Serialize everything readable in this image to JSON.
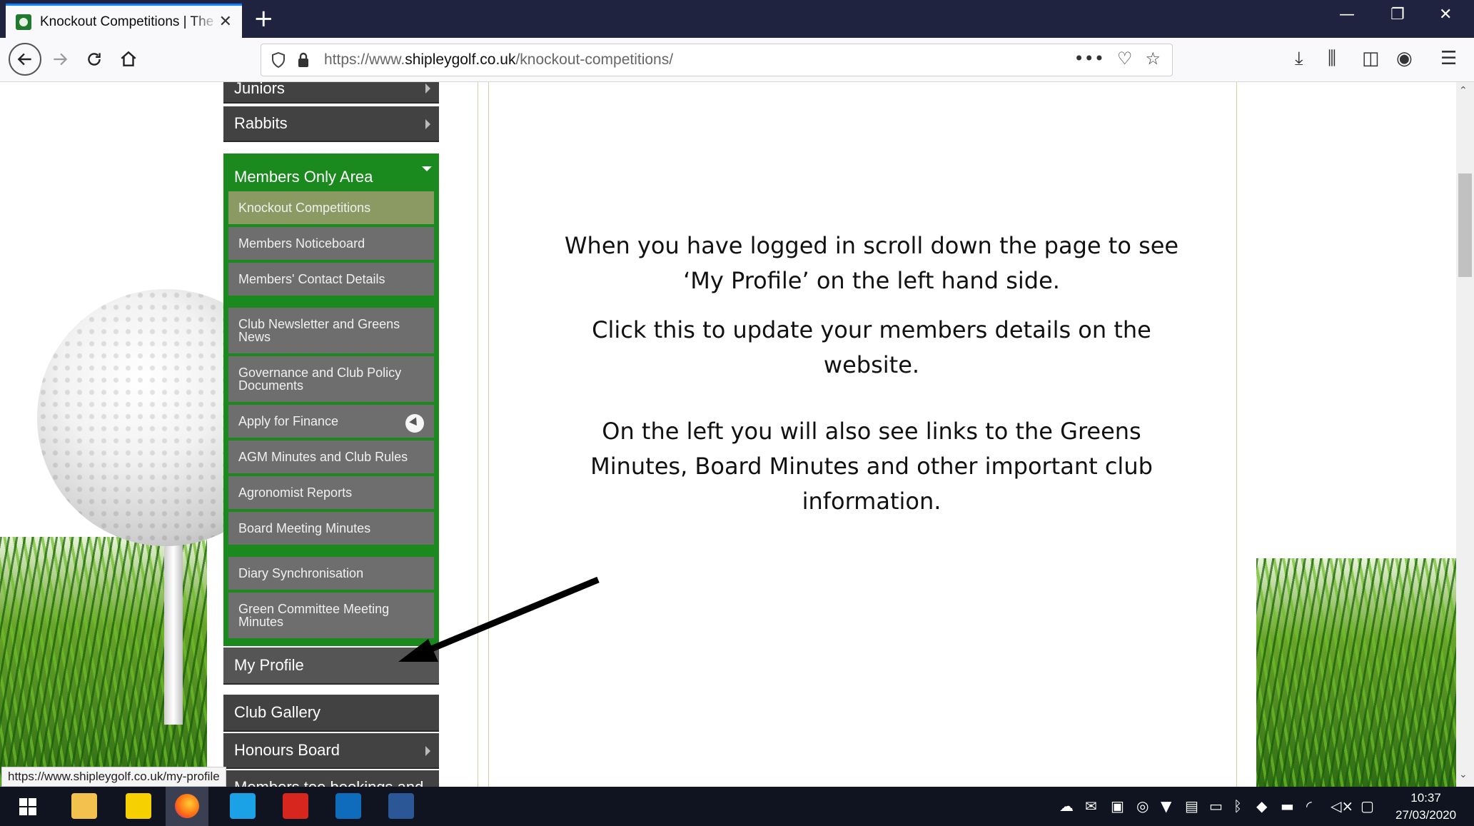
{
  "browser": {
    "tab_title": "Knockout Competitions | The S",
    "new_tab_symbol": "+",
    "url_prefix": "https://www.",
    "url_domain": "shipleygolf.co.uk",
    "url_path": "/knockout-competitions/",
    "status_url": "https://www.shipleygolf.co.uk/my-profile"
  },
  "sidebar": {
    "top_items": [
      {
        "label": "Juniors"
      },
      {
        "label": "Rabbits"
      }
    ],
    "members_area": {
      "label": "Members Only Area",
      "items": [
        {
          "label": "Knockout Competitions"
        },
        {
          "label": "Members Noticeboard"
        },
        {
          "label": "Members' Contact Details"
        },
        {
          "label": "Club Newsletter and Greens News"
        },
        {
          "label": "Governance and Club Policy Documents"
        },
        {
          "label": "Apply for Finance"
        },
        {
          "label": "AGM Minutes and Club Rules"
        },
        {
          "label": "Agronomist Reports"
        },
        {
          "label": "Board Meeting Minutes"
        },
        {
          "label": "Diary Synchronisation"
        },
        {
          "label": "Green Committee Meeting Minutes"
        }
      ]
    },
    "bottom_items": [
      {
        "label": "My Profile"
      },
      {
        "label": "Club Gallery"
      },
      {
        "label": "Honours Board"
      },
      {
        "label": "Members tee bookings and"
      }
    ]
  },
  "content": {
    "para1": "When you have logged in scroll down the page to see ‘My Profile’ on the left hand side.",
    "para2": "Click this to update your members details on the website.",
    "para3": "On the left you will also see links to the Greens Minutes, Board Minutes and other important club information."
  },
  "taskbar": {
    "time": "10:37",
    "date": "27/03/2020"
  }
}
